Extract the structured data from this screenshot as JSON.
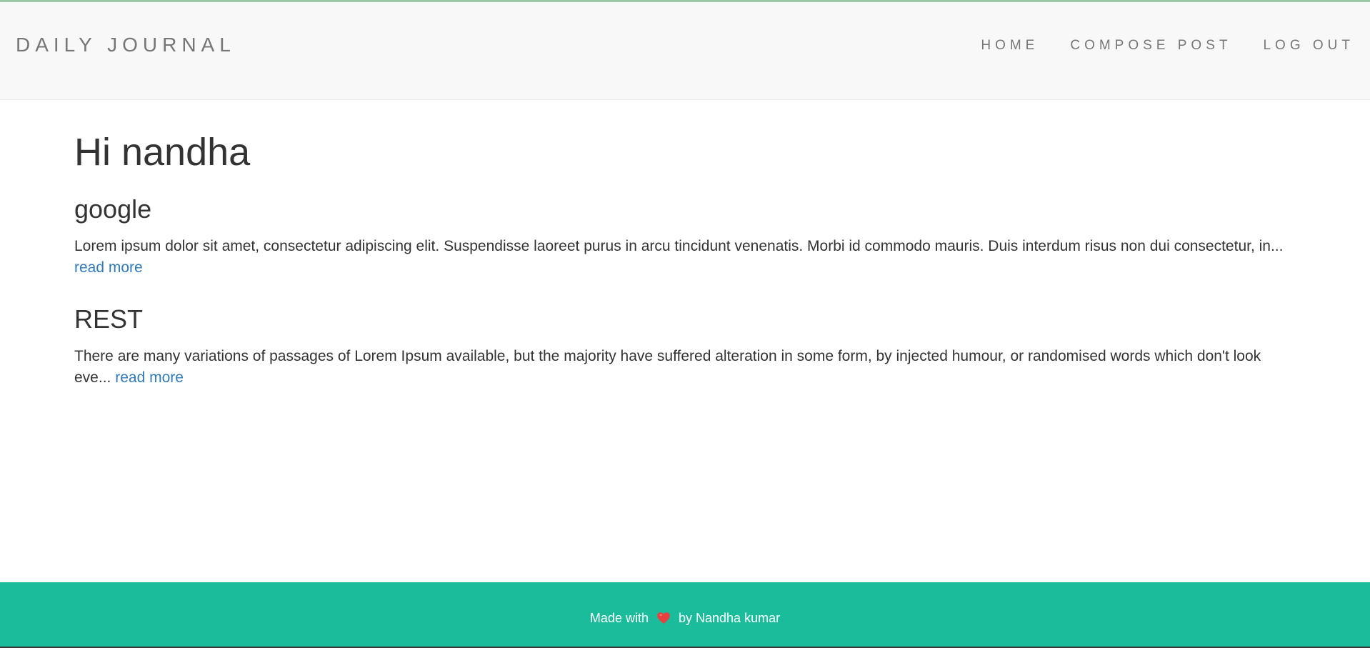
{
  "navbar": {
    "brand": "DAILY JOURNAL",
    "links": [
      {
        "label": "HOME"
      },
      {
        "label": "COMPOSE POST"
      },
      {
        "label": "LOG OUT"
      }
    ]
  },
  "main": {
    "greeting": "Hi nandha",
    "posts": [
      {
        "title": "google",
        "excerpt": "Lorem ipsum dolor sit amet, consectetur adipiscing elit. Suspendisse laoreet purus in arcu tincidunt venenatis. Morbi id commodo mauris. Duis interdum risus non dui consectetur, in...",
        "read_more": "read more"
      },
      {
        "title": "REST",
        "excerpt": "There are many variations of passages of Lorem Ipsum available, but the majority have suffered alteration in some form, by injected humour, or randomised words which don't look eve...",
        "read_more": "read more"
      }
    ]
  },
  "footer": {
    "prefix": "Made with",
    "icon": "heart-icon",
    "suffix": "by Nandha kumar"
  },
  "colors": {
    "footer_bg": "#1abc9c",
    "link": "#337ab7",
    "navbar_bg": "#f8f8f8",
    "heart": "#e8403f"
  }
}
